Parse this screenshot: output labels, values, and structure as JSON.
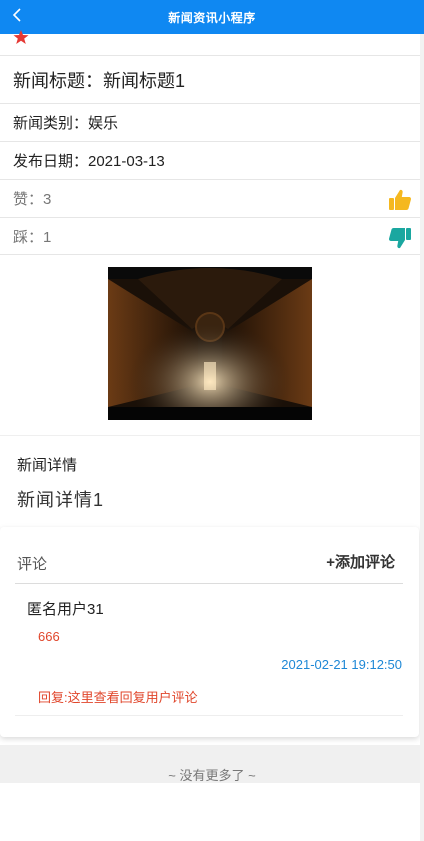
{
  "navbar": {
    "title": "新闻资讯小程序"
  },
  "news": {
    "title_text": "新闻标题：新闻标题1",
    "category_text": "新闻类别：娱乐",
    "date_text": "发布日期：2021-03-13",
    "likes_text": "赞：3",
    "dislikes_text": "踩：1"
  },
  "detail": {
    "label": "新闻详情",
    "content": "新闻详情1"
  },
  "comments": {
    "title": "评论",
    "add_label": "+添加评论",
    "items": [
      {
        "user": "匿名用户31",
        "text": "666",
        "time": "2021-02-21 19:12:50",
        "reply": "回复:这里查看回复用户评论"
      }
    ]
  },
  "footer": {
    "no_more": "~ 没有更多了 ~"
  },
  "colors": {
    "navbar": "#0f88f2",
    "like_icon": "#f5b81f",
    "dislike_icon": "#1aa7a0",
    "comment_text": "#e0462b",
    "comment_time": "#1e88d6",
    "star": "#e53935"
  },
  "icons": {
    "back": "chevron-left-icon",
    "favorite": "star-icon",
    "like": "thumbs-up-icon",
    "dislike": "thumbs-down-icon"
  }
}
